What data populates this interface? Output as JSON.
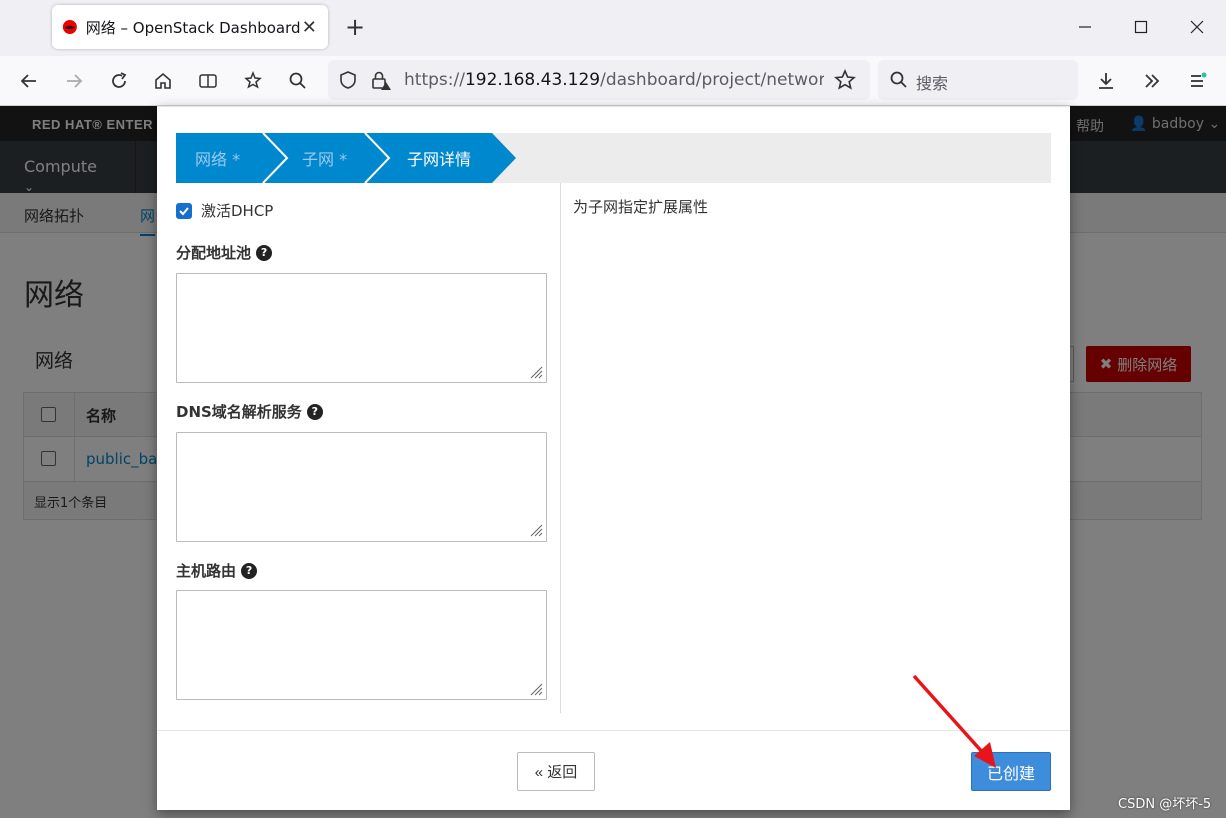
{
  "browser": {
    "tab_title": "网络 – OpenStack Dashboard",
    "url_prefix": "https://",
    "url_host": "192.168.43.129",
    "url_path": "/dashboard/project/networks",
    "search_placeholder": "搜索"
  },
  "masthead": {
    "brand": "RED HAT® ENTER",
    "help": "帮助",
    "user": "badboy"
  },
  "nav": {
    "compute": "Compute"
  },
  "breadcrumbs": {
    "topology": "网络拓扑",
    "networks": "网"
  },
  "page": {
    "title": "网络",
    "table_title": "网络",
    "delete_button": "删除网络",
    "column_name": "名称",
    "row_name": "public_ba",
    "footer_count": "显示1个条目"
  },
  "modal": {
    "steps": [
      {
        "label": "网络 *",
        "state": "completed"
      },
      {
        "label": "子网 *",
        "state": "completed"
      },
      {
        "label": "子网详情",
        "state": "active"
      }
    ],
    "dhcp_checkbox": {
      "label": "激活DHCP",
      "checked": true
    },
    "fields": {
      "allocation_pools": {
        "label": "分配地址池",
        "value": ""
      },
      "dns_servers": {
        "label": "DNS域名解析服务",
        "value": ""
      },
      "host_routes": {
        "label": "主机路由",
        "value": ""
      }
    },
    "help_text": "为子网指定扩展属性",
    "back_button": "« 返回",
    "create_button": "已创建"
  },
  "watermark": "CSDN @坏坏-5",
  "colors": {
    "wizard_active": "#0088ce",
    "primary_button": "#3e8ddd",
    "danger_button": "#cc0000",
    "annotation_arrow": "#e8141b"
  }
}
